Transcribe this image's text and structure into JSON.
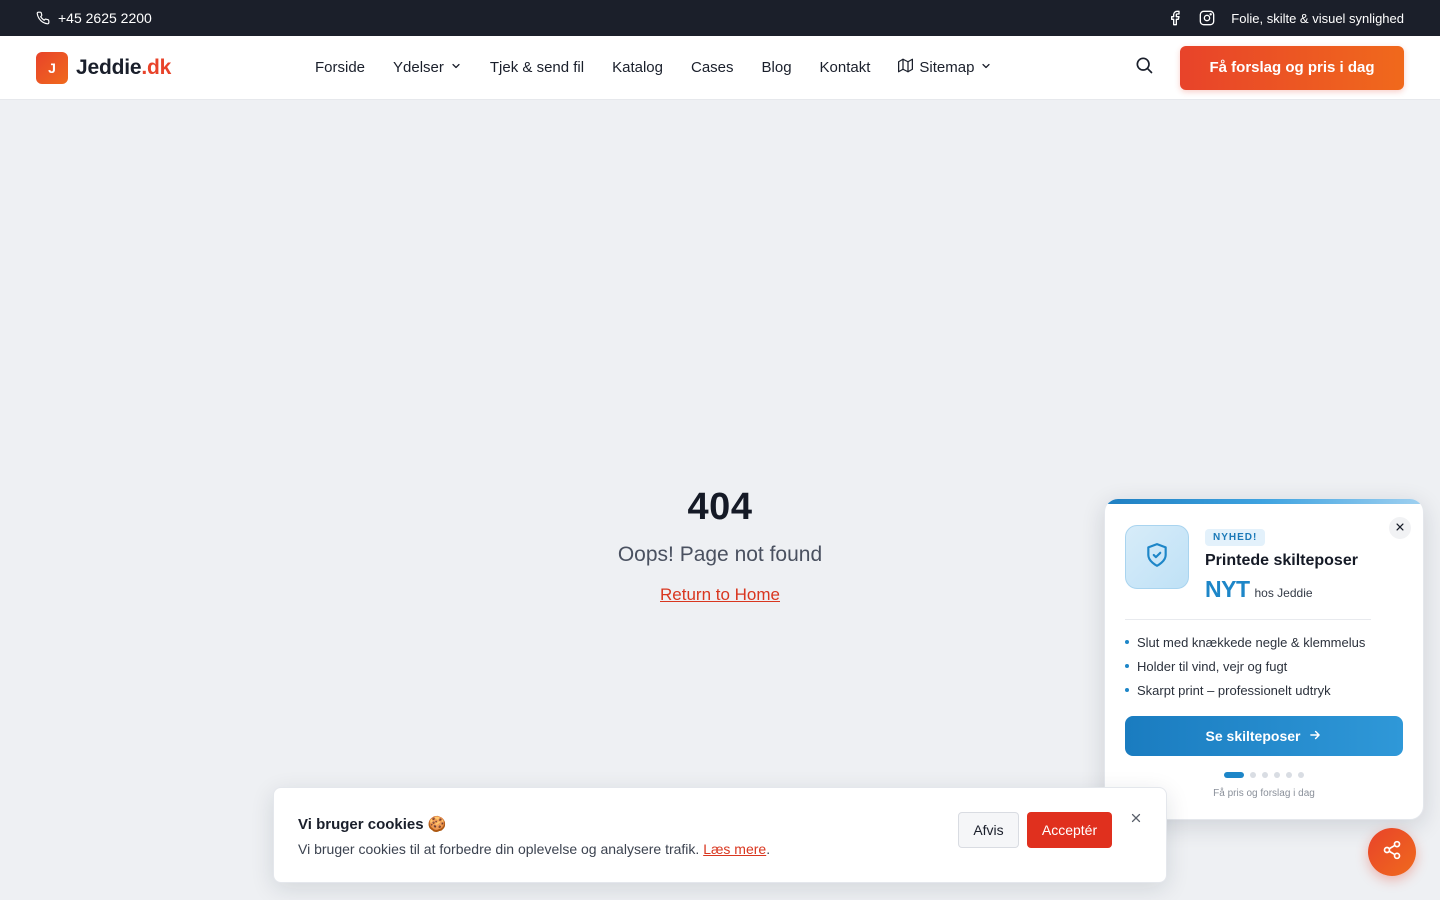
{
  "topbar": {
    "phone": "+45 2625 2200",
    "tagline": "Folie, skilte & visuel synlighed",
    "icons": [
      "phone-icon",
      "facebook-icon",
      "instagram-icon"
    ]
  },
  "header": {
    "logo_mark": "J",
    "logo_name": "Jeddie",
    "logo_tld": ".dk",
    "nav": [
      {
        "label": "Forside"
      },
      {
        "label": "Ydelser",
        "dropdown": true
      },
      {
        "label": "Tjek & send fil"
      },
      {
        "label": "Katalog"
      },
      {
        "label": "Cases"
      },
      {
        "label": "Blog"
      },
      {
        "label": "Kontakt"
      },
      {
        "label": "Sitemap",
        "dropdown": true,
        "icon": "map-icon"
      }
    ],
    "cta_label": "Få forslag og pris i dag"
  },
  "notfound": {
    "code": "404",
    "message": "Oops! Page not found",
    "link": "Return to Home"
  },
  "promo": {
    "badge": "NYHED!",
    "title": "Printede skilteposer",
    "highlight": "NYT",
    "highlight_suffix": "hos Jeddie",
    "bullets": [
      "Slut med knækkede negle & klemmelus",
      "Holder til vind, vejr og fugt",
      "Skarpt print – professionelt udtryk"
    ],
    "button": "Se skilteposer",
    "slides_total": 6,
    "slide_active": 1,
    "footer": "Få pris og forslag i dag"
  },
  "cookie": {
    "title": "Vi bruger cookies 🍪",
    "text": "Vi bruger cookies til at forbedre din oplevelse og analysere trafik.",
    "link": "Læs mere",
    "decline": "Afvis",
    "accept": "Acceptér"
  },
  "colors": {
    "brand": "#e8432a",
    "dark": "#1b1f2a",
    "promo_accent": "#1d86c8",
    "background": "#eef0f3"
  }
}
